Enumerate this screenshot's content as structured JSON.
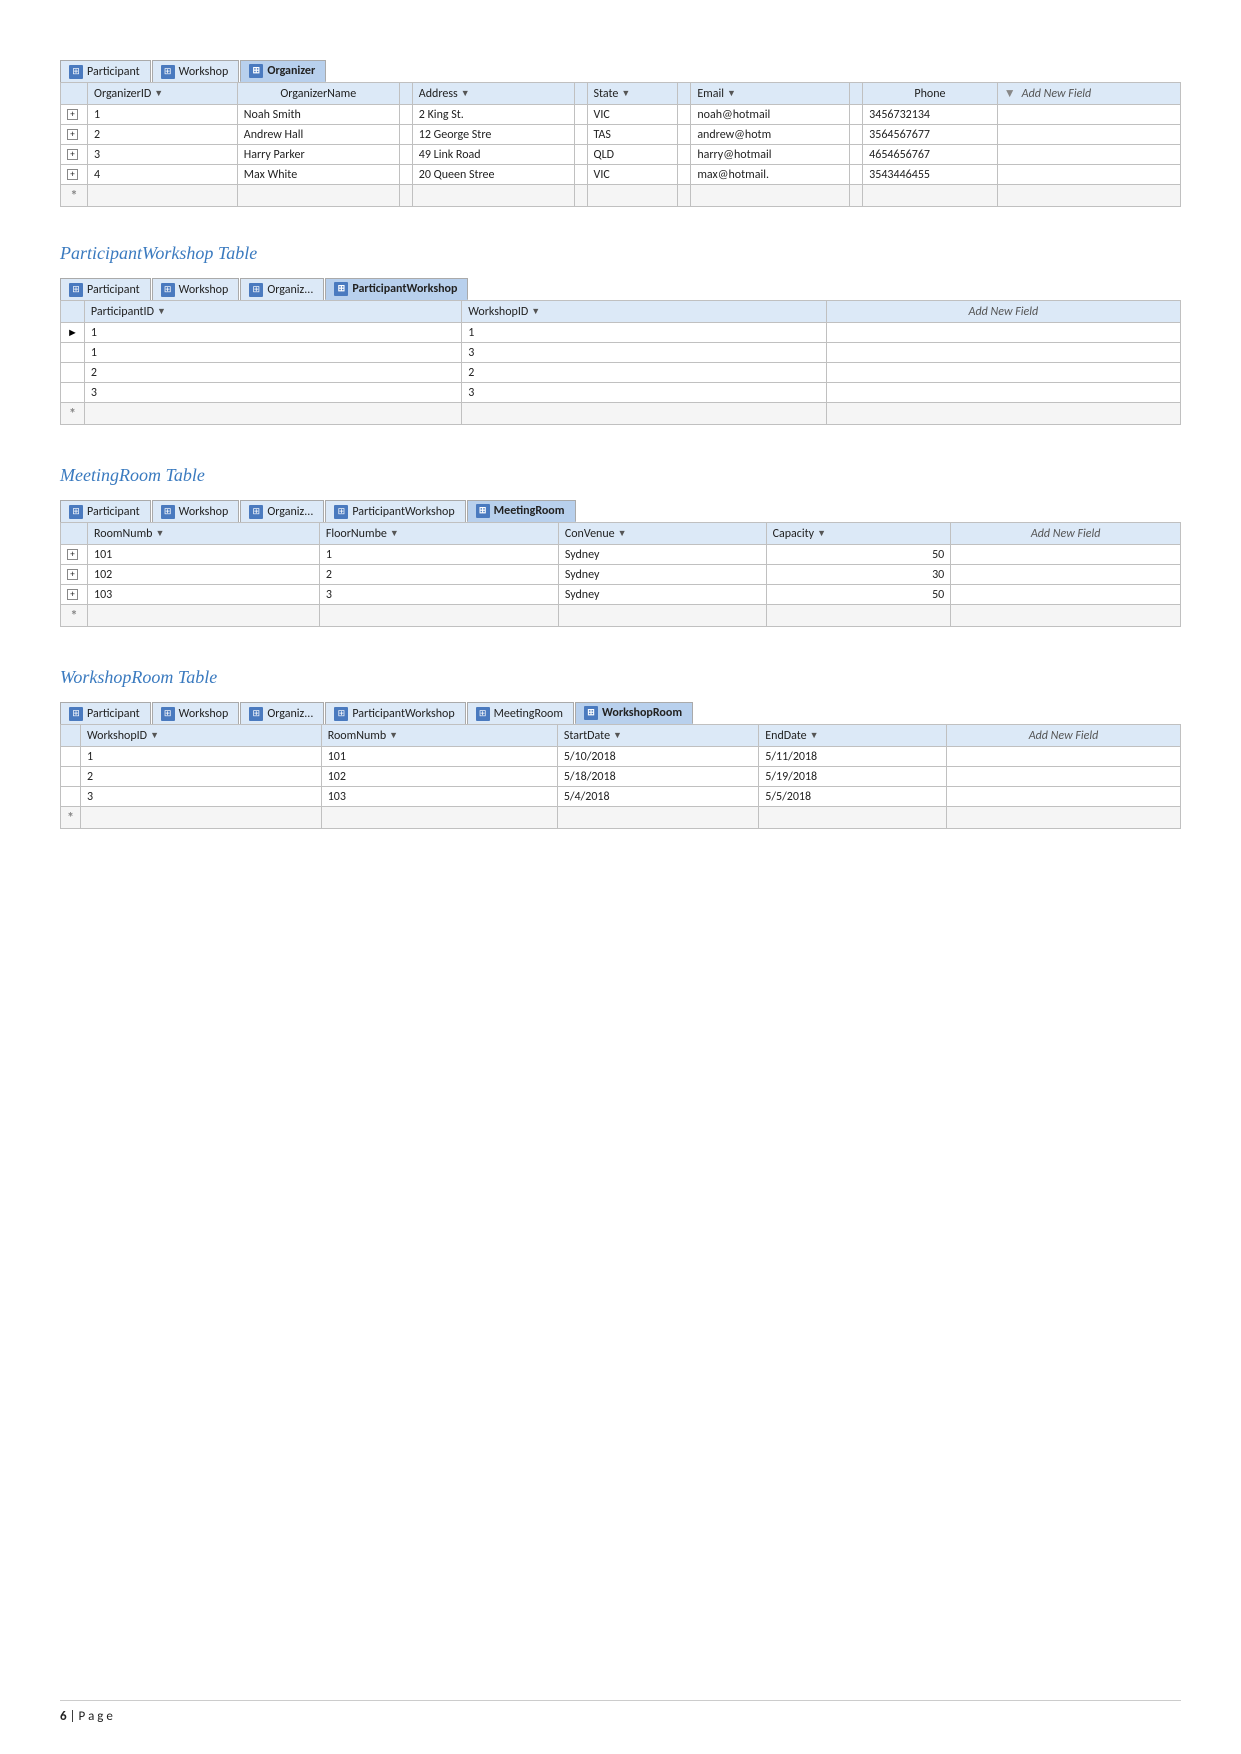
{
  "tabs": {
    "organizer_table": {
      "tabs": [
        "Participant",
        "Workshop",
        "Organizer"
      ],
      "active": "Organizer",
      "columns": [
        "OrganizerID",
        "OrganizerName",
        "Address",
        "State",
        "Email",
        "Phone",
        "Add New Field"
      ],
      "rows": [
        {
          "id": "1",
          "name": "Noah Smith",
          "address": "2 King St.",
          "state": "VIC",
          "email": "noah@hotmail",
          "phone": "3456732134"
        },
        {
          "id": "2",
          "name": "Andrew Hall",
          "address": "12 George Stre",
          "state": "TAS",
          "email": "andrew@hotm",
          "phone": "3564567677"
        },
        {
          "id": "3",
          "name": "Harry Parker",
          "address": "49 Link Road",
          "state": "QLD",
          "email": "harry@hotmail",
          "phone": "4654656767"
        },
        {
          "id": "4",
          "name": "Max White",
          "address": "20 Queen Stree",
          "state": "VIC",
          "email": "max@hotmail.",
          "phone": "3543446455"
        }
      ]
    },
    "participant_workshop_table": {
      "title": "ParticipantWorkshop Table",
      "tabs": [
        "Participant",
        "Workshop",
        "Organiz...",
        "ParticipantWorkshop"
      ],
      "active": "ParticipantWorkshop",
      "columns": [
        "ParticipantID",
        "WorkshopID",
        "Add New Field"
      ],
      "rows": [
        {
          "pid": "1",
          "wid": "1"
        },
        {
          "pid": "1",
          "wid": "3"
        },
        {
          "pid": "2",
          "wid": "2"
        },
        {
          "pid": "3",
          "wid": "3"
        }
      ]
    },
    "meeting_room_table": {
      "title": "MeetingRoom Table",
      "tabs": [
        "Participant",
        "Workshop",
        "Organiz...",
        "ParticipantWorkshop",
        "MeetingRoom"
      ],
      "active": "MeetingRoom",
      "columns": [
        "RoomNumber",
        "FloorNumber",
        "ConVenue",
        "Capacity",
        "Add New Field"
      ],
      "rows": [
        {
          "room": "101",
          "floor": "1",
          "venue": "Sydney",
          "capacity": "50"
        },
        {
          "room": "102",
          "floor": "2",
          "venue": "Sydney",
          "capacity": "30"
        },
        {
          "room": "103",
          "floor": "3",
          "venue": "Sydney",
          "capacity": "50"
        }
      ]
    },
    "workshop_room_table": {
      "title": "WorkshopRoom Table",
      "tabs": [
        "Participant",
        "Workshop",
        "Organiz...",
        "ParticipantWorkshop",
        "MeetingRoom",
        "WorkshopRoom"
      ],
      "active": "WorkshopRoom",
      "columns": [
        "WorkshopID",
        "RoomNumber",
        "StartDate",
        "EndDate",
        "Add New Field"
      ],
      "rows": [
        {
          "wid": "1",
          "room": "101",
          "start": "5/10/2018",
          "end": "5/11/2018"
        },
        {
          "wid": "2",
          "room": "102",
          "start": "5/18/2018",
          "end": "5/19/2018"
        },
        {
          "wid": "3",
          "room": "103",
          "start": "5/4/2018",
          "end": "5/5/2018"
        }
      ]
    }
  },
  "footer": {
    "page_num": "6",
    "page_label": "| P a g e"
  }
}
